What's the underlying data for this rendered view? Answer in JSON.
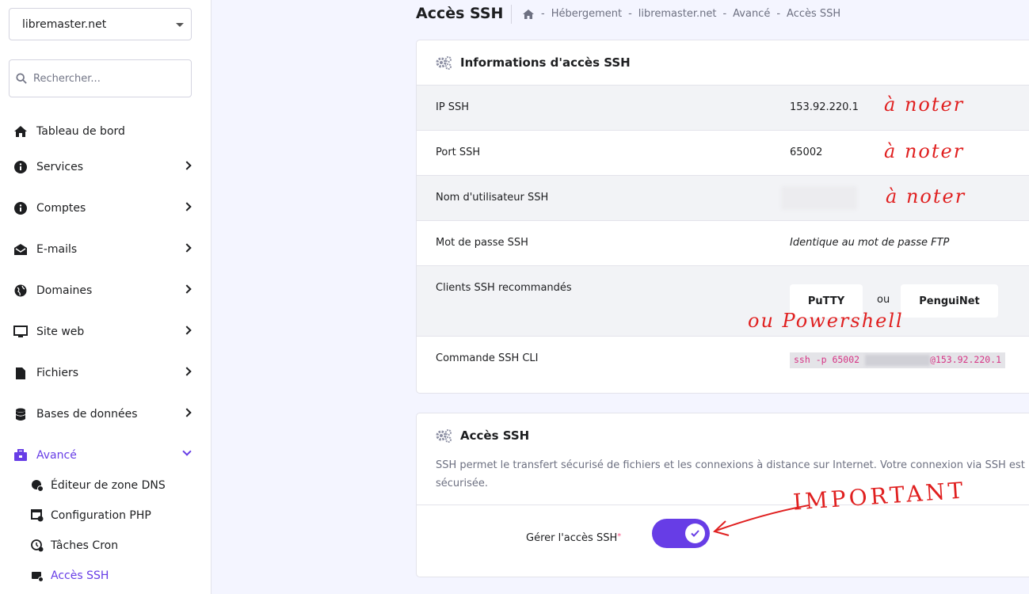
{
  "sidebar": {
    "domain": "libremaster.net",
    "search_placeholder": "Rechercher...",
    "items": [
      {
        "label": "Tableau de bord"
      },
      {
        "label": "Services"
      },
      {
        "label": "Comptes"
      },
      {
        "label": "E-mails"
      },
      {
        "label": "Domaines"
      },
      {
        "label": "Site web"
      },
      {
        "label": "Fichiers"
      },
      {
        "label": "Bases de données"
      },
      {
        "label": "Avancé"
      }
    ],
    "sub_items": [
      {
        "label": "Éditeur de zone DNS"
      },
      {
        "label": "Configuration PHP"
      },
      {
        "label": "Tâches Cron"
      },
      {
        "label": "Accès SSH"
      }
    ]
  },
  "header": {
    "title": "Accès SSH",
    "breadcrumb": [
      "Hébergement",
      "libremaster.net",
      "Avancé",
      "Accès SSH"
    ]
  },
  "ssh_info": {
    "title": "Informations d'accès SSH",
    "ip_label": "IP SSH",
    "ip_value": "153.92.220.1",
    "port_label": "Port SSH",
    "port_value": "65002",
    "user_label": "Nom d'utilisateur SSH",
    "password_label": "Mot de passe SSH",
    "password_value": "Identique au mot de passe FTP",
    "clients_label": "Clients SSH recommandés",
    "client_1": "PuTTY",
    "client_or": "ou",
    "client_2": "PenguiNet",
    "cli_label": "Commande SSH CLI",
    "cli_prefix": "ssh -p 65002 ",
    "cli_suffix": "@153.92.220.1"
  },
  "annotations": {
    "note_1": "à noter",
    "note_2": "à noter",
    "note_3": "à noter",
    "powershell": "ou Powershell",
    "important": "IMPORTANT"
  },
  "ssh_access": {
    "title": "Accès SSH",
    "description": "SSH permet le transfert sécurisé de fichiers et les connexions à distance sur Internet. Votre connexion via SSH est sécurisée.",
    "toggle_label": "Gérer l'accès SSH",
    "required_mark": "*",
    "toggle_on": true
  },
  "colors": {
    "accent": "#673de6",
    "annotation": "#e02020"
  }
}
